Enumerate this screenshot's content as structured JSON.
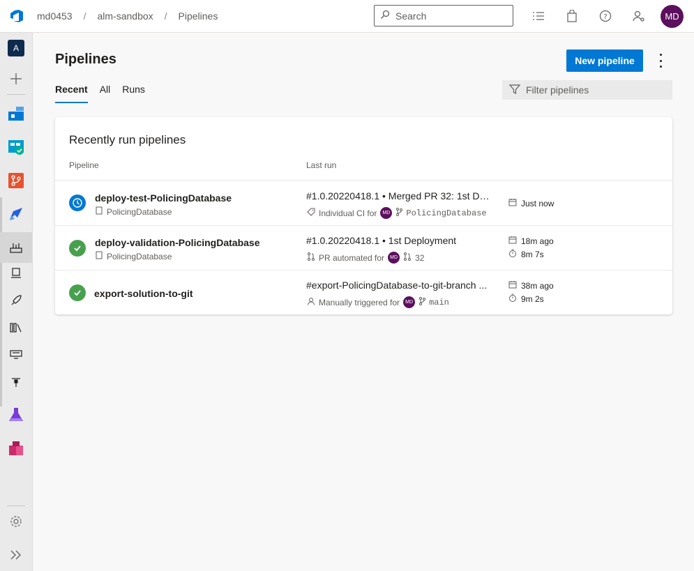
{
  "app": {
    "breadcrumbs": [
      "md0453",
      "alm-sandbox",
      "Pipelines"
    ],
    "search_placeholder": "Search",
    "user_initials": "MD",
    "org_initial": "A"
  },
  "header": {
    "title": "Pipelines",
    "new_pipeline_label": "New pipeline",
    "tabs": [
      {
        "label": "Recent",
        "active": true
      },
      {
        "label": "All",
        "active": false
      },
      {
        "label": "Runs",
        "active": false
      }
    ],
    "filter_placeholder": "Filter pipelines"
  },
  "card": {
    "title": "Recently run pipelines",
    "col_pipeline": "Pipeline",
    "col_last_run": "Last run",
    "rows": [
      {
        "status": "running",
        "name": "deploy-test-PolicingDatabase",
        "folder": "PolicingDatabase",
        "run_title": "#1.0.20220418.1 • Merged PR 32: 1st Deployment",
        "trigger_text": "Individual CI for",
        "trigger_initials": "MD",
        "ref": "PolicingDatabase",
        "time": "Just now",
        "duration": ""
      },
      {
        "status": "success",
        "name": "deploy-validation-PolicingDatabase",
        "folder": "PolicingDatabase",
        "run_title": "#1.0.20220418.1 • 1st Deployment",
        "trigger_text": "PR automated for",
        "trigger_initials": "MD",
        "ref": "32",
        "time": "18m ago",
        "duration": "8m 7s"
      },
      {
        "status": "success",
        "name": "export-solution-to-git",
        "folder": "",
        "run_title": "#export-PolicingDatabase-to-git-branch ...",
        "trigger_text": "Manually triggered for",
        "trigger_initials": "MD",
        "ref": "main",
        "time": "38m ago",
        "duration": "9m 2s"
      }
    ]
  },
  "colors": {
    "accent": "#0078d4",
    "success": "#48a04f",
    "avatar": "#5c0f5e"
  }
}
